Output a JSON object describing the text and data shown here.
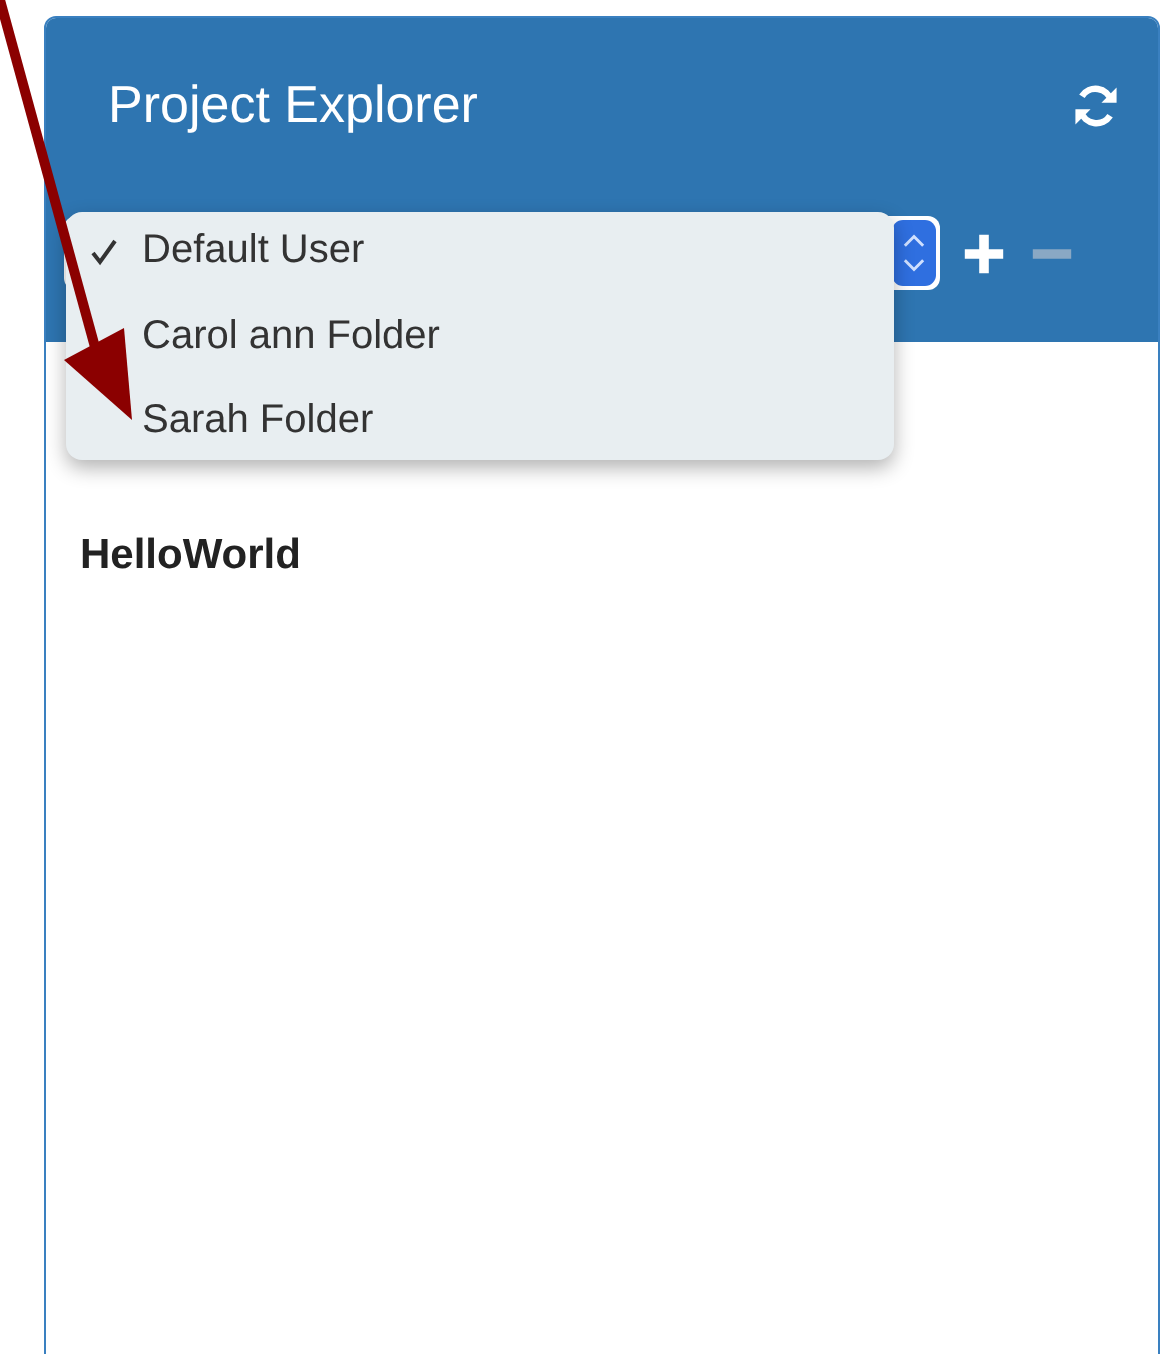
{
  "panel": {
    "title": "Project Explorer"
  },
  "toolbar": {
    "add_disabled": false,
    "remove_disabled": true
  },
  "dropdown_menu": {
    "items": [
      {
        "label": "Default User",
        "selected": true
      },
      {
        "label": "Carol ann Folder",
        "selected": false
      },
      {
        "label": "Sarah Folder",
        "selected": false
      }
    ]
  },
  "tree": {
    "items": [
      {
        "label": "HelloWorld"
      }
    ]
  }
}
